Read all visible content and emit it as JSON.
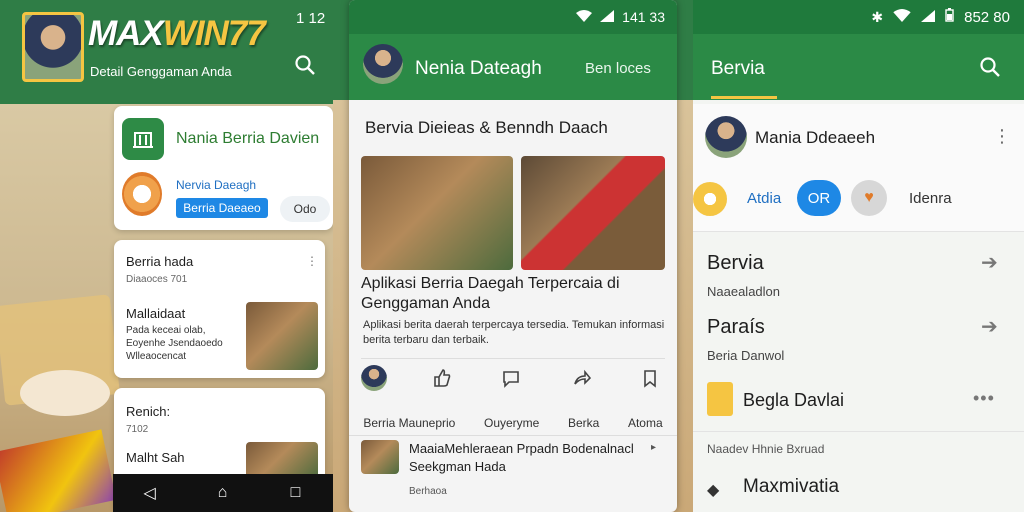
{
  "left": {
    "brand": {
      "max": "MAX",
      "win": "WIN",
      "num": "77",
      "subtitle": "Detail Genggaman Anda"
    },
    "status": "1 12",
    "card1": {
      "title": "Nania Berria Davien",
      "name": "Nervia Daeagh",
      "button": "Berria Daeaeo",
      "pill": "Odo"
    },
    "card2": {
      "title": "Berria hada",
      "meta": "Diaaoces 701",
      "item_title": "Mallaidaat",
      "item_text": "Pada keceai olab, Eoyenhe Jsendaoedo Wlleaocencat"
    },
    "card3": {
      "title": "Renich:",
      "meta": "7102",
      "item_title": "Malht Sah"
    },
    "nav": {
      "back": "◁",
      "home": "⌂",
      "recent": "□"
    }
  },
  "center": {
    "status_time": "141 33",
    "app_name": "Nenia Dateagh",
    "app_tab": "Ben loces",
    "heading": "Bervia Dieieas & Benndh Daach",
    "article_title": "Aplikasi Berria Daegah Terpercaia di Genggaman Anda",
    "article_body": "Aplikasi berita daerah terpercaya tersedia. Temukan informasi berita terbaru dan terbaik.",
    "tabs": [
      "Berria Mauneprio",
      "Ouyeryme",
      "Berka",
      "Atoma"
    ],
    "item_title": "MaaiaMehleraean Prpadn Bodenalnacl Seekgman Hada",
    "item_meta": "Berhaoa"
  },
  "right": {
    "status_time": "852 80",
    "app_title": "Bervia",
    "profile_name": "Mania Ddeaeeh",
    "chips": {
      "label1": "Atdia",
      "button": "OR",
      "label3": "Idenra"
    },
    "rows": [
      {
        "title": "Bervia",
        "sub": "Naaealadlon"
      },
      {
        "title": "Paraís",
        "sub": "Beria Danwol"
      }
    ],
    "featured": "Begla Davlai",
    "section": "Naadev Hhnie Bxruad",
    "last": "Maxmivatia"
  }
}
